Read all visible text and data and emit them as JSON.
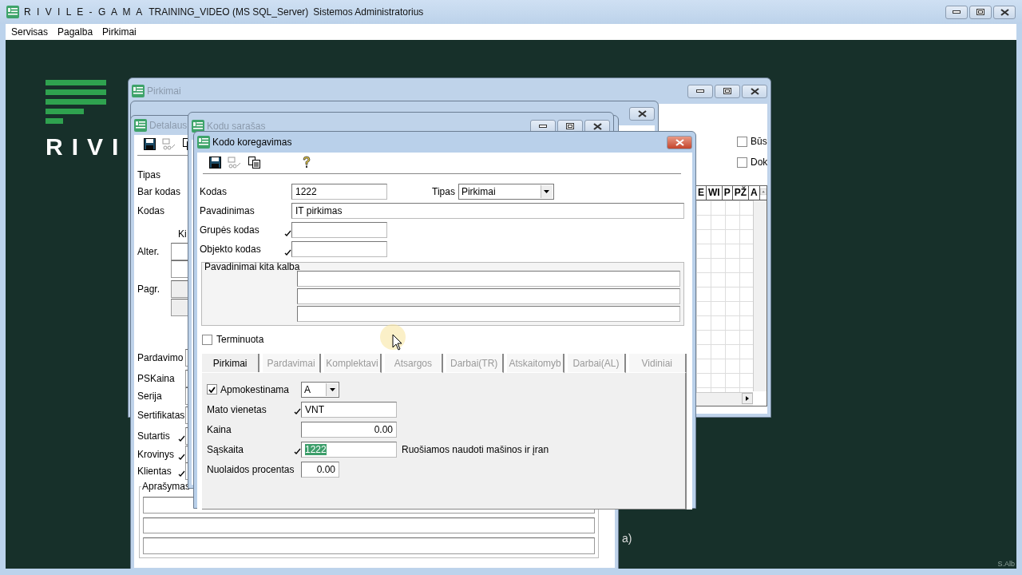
{
  "app": {
    "title": "R I V I L E - G A M A",
    "database": "TRAINING_VIDEO (MS SQL_Server)",
    "user": "Sistemos Administratorius"
  },
  "menu": [
    {
      "label": "Servisas"
    },
    {
      "label": "Pagalba"
    },
    {
      "label": "Pirkimai"
    }
  ],
  "logo": {
    "text": "RIVI"
  },
  "workspace_fragment": "a)",
  "corner_mark": "S.Alb",
  "purchases_window": {
    "title": "Pirkimai",
    "checkboxes": [
      {
        "label": "Būs",
        "checked": false
      },
      {
        "label": "Dok",
        "checked": false
      }
    ],
    "grid_columns": [
      "E",
      "WI",
      "P",
      "PŽ",
      "A"
    ]
  },
  "detail_window": {
    "title": "Detalaus",
    "rows": [
      {
        "kind": "label",
        "label": "Tipas"
      },
      {
        "kind": "label",
        "label": "Bar kodas"
      },
      {
        "kind": "label",
        "label": "Kodas"
      },
      {
        "kind": "heading",
        "label": "Ki"
      },
      {
        "kind": "field",
        "label": "Alter."
      },
      {
        "kind": "field"
      },
      {
        "kind": "shaded_field",
        "label": "Pagr."
      },
      {
        "kind": "shaded_field"
      },
      {
        "kind": "edge",
        "label": "Pardavimo"
      },
      {
        "kind": "edge",
        "label": "PSKaina"
      },
      {
        "kind": "edge",
        "label": "Serija"
      },
      {
        "kind": "edge",
        "label": "Sertifikatas"
      },
      {
        "kind": "lookup_edge",
        "label": "Sutartis"
      },
      {
        "kind": "lookup_edge",
        "label": "Krovinys"
      },
      {
        "kind": "lookup_edge",
        "label": "Klientas"
      }
    ],
    "description_group": "Aprašymas"
  },
  "code_list_window": {
    "title": "Kodu sarašas"
  },
  "dialog": {
    "title": "Kodo koregavimas",
    "fields": [
      {
        "label": "Kodas",
        "kind": "short",
        "value": "1222",
        "lookup": false,
        "side_select": {
          "label": "Tipas",
          "value": "Pirkimai"
        }
      },
      {
        "label": "Pavadinimas",
        "kind": "wide",
        "value": "IT pirkimas",
        "lookup": false
      },
      {
        "label": "Grupės kodas",
        "kind": "short",
        "lookup": true
      },
      {
        "label": "Objekto kodas",
        "kind": "short",
        "lookup": true
      }
    ],
    "other_languages": {
      "title": "Pavadinimai kita kalba"
    },
    "terminated": {
      "label": "Terminuota",
      "checked": false
    },
    "tabs": [
      {
        "label": "Pirkimai",
        "selected": true,
        "disabled": false
      },
      {
        "label": "Pardavimai",
        "selected": false,
        "disabled": true
      },
      {
        "label": "Komplektavi",
        "selected": false,
        "disabled": true
      },
      {
        "label": "Atsargos",
        "selected": false,
        "disabled": true
      },
      {
        "label": "Darbai(TR)",
        "selected": false,
        "disabled": true
      },
      {
        "label": "Atskaitomyb",
        "selected": false,
        "disabled": true
      },
      {
        "label": "Darbai(AL)",
        "selected": false,
        "disabled": true
      },
      {
        "label": "Vidiniai",
        "selected": false,
        "disabled": true
      }
    ],
    "panel_rows": [
      {
        "kind": "checkbox_select",
        "label": "Apmokestinama",
        "checked": true,
        "value": "A"
      },
      {
        "kind": "field",
        "label": "Mato vienetas",
        "lookup": true,
        "value": "VNT",
        "highlighted": false
      },
      {
        "kind": "number",
        "label": "Kaina",
        "value": "0.00"
      },
      {
        "kind": "field",
        "label": "Sąskaita",
        "lookup": true,
        "value": "1222",
        "highlighted": true,
        "description": "Ruošiamos naudoti mašinos ir įran"
      },
      {
        "kind": "short_number",
        "label": "Nuolaidos procentas",
        "value": "0.00"
      }
    ]
  }
}
